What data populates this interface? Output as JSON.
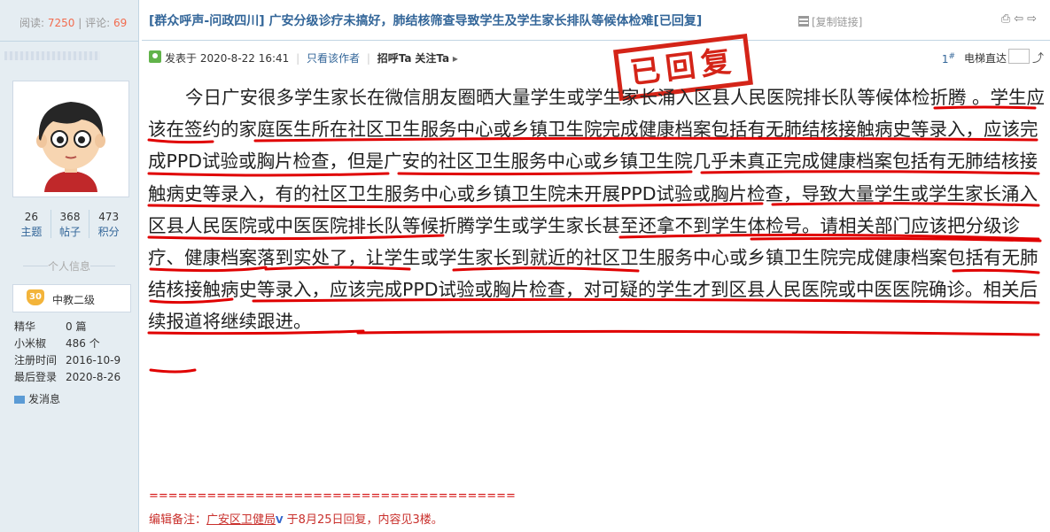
{
  "stats": {
    "views_label": "阅读:",
    "views": "7250",
    "divider": "|",
    "comments_label": "评论:",
    "comments": "69"
  },
  "user": {
    "counts": [
      {
        "value": "26",
        "label": "主题"
      },
      {
        "value": "368",
        "label": "帖子"
      },
      {
        "value": "473",
        "label": "积分"
      }
    ],
    "personal_info_label": "个人信息",
    "rank_badge": "30",
    "rank_title": "中教二级",
    "info": [
      {
        "key": "精华",
        "value": "0 篇"
      },
      {
        "key": "小米椒",
        "value": "486 个"
      },
      {
        "key": "注册时间",
        "value": "2016-10-9"
      },
      {
        "key": "最后登录",
        "value": "2020-8-26"
      }
    ],
    "message_label": "发消息"
  },
  "thread": {
    "title": "[群众呼声-问政四川] 广安分级诊疗未搞好，肺结核筛查导致学生及学生家长排队等候体检难[已回复]",
    "copy_link": "[复制链接]",
    "top_icons": "⎙⇦⇨"
  },
  "post": {
    "posted_label": "发表于 2020-8-22 16:41",
    "sep": "|",
    "author_only": "只看该作者",
    "greet": "招呼Ta",
    "follow": "关注Ta",
    "more_arrow": "▸",
    "floor_number": "1",
    "floor_mark": "#",
    "elevator_label": "电梯直达",
    "elevator_go": "⤴",
    "stamp": "已回复",
    "body": "今日广安很多学生家长在微信朋友圈晒大量学生或学生家长涌入区县人民医院排长队等候体检折腾 。学生应该在签约的家庭医生所在社区卫生服务中心或乡镇卫生院完成健康档案包括有无肺结核接触病史等录入，应该完成PPD试验或胸片检查，但是广安的社区卫生服务中心或乡镇卫生院几乎未真正完成健康档案包括有无肺结核接触病史等录入，有的社区卫生服务中心或乡镇卫生院未开展PPD试验或胸片检查，导致大量学生或学生家长涌入区县人民医院或中医医院排长队等候折腾学生或学生家长甚至还拿不到学生体检号。请相关部门应该把分级诊疗、健康档案落到实处了，让学生或学生家长到就近的社区卫生服务中心或乡镇卫生院完成健康档案包括有无肺结核接触病史等录入，应该完成PPD试验或胸片检查，对可疑的学生才到区县人民医院或中医医院确诊。相关后续报道将继续跟进。",
    "separator_line": "======================================",
    "edit_note_prefix": "编辑备注：",
    "edit_note_who": "广安区卫健局",
    "edit_note_v": "V",
    "edit_note_suffix": " 于8月25日回复，内容见3楼。"
  },
  "colors": {
    "link": "#336699",
    "stamp": "#d42418",
    "underline": "#e00000",
    "sidebar": "#e5edf2"
  }
}
